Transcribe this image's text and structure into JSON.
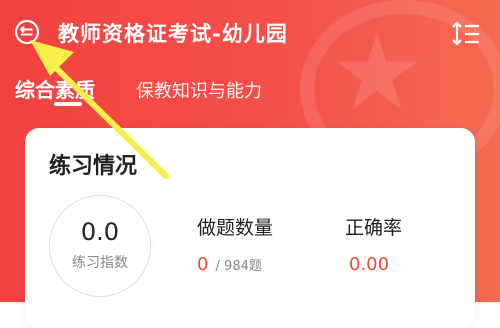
{
  "header": {
    "title": "教师资格证考试-幼儿园",
    "back_icon": "back-circle-icon",
    "sort_icon": "sort-icon"
  },
  "tabs": [
    {
      "label": "综合素质",
      "active": true
    },
    {
      "label": "保教知识与能力",
      "active": false
    }
  ],
  "practice": {
    "title": "练习情况",
    "index_value": "0.0",
    "index_label": "练习指数",
    "questions_label": "做题数量",
    "questions_done": "0",
    "questions_total": "/ 984题",
    "accuracy_label": "正确率",
    "accuracy_value": "0.00"
  },
  "colors": {
    "primary": "#f2413f",
    "accent_text": "#ef4b3c",
    "annotation_arrow": "#f6ee4a"
  }
}
